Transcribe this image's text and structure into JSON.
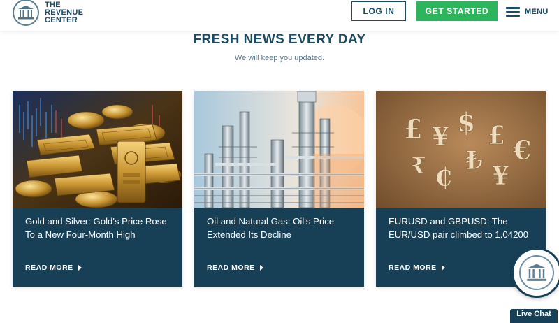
{
  "header": {
    "logo_lines": [
      "THE",
      "REVENUE",
      "CENTER"
    ],
    "login_label": "LOG IN",
    "get_started_label": "GET STARTED",
    "menu_label": "MENU"
  },
  "section": {
    "title": "FRESH NEWS EVERY DAY",
    "subtitle": "We will keep you updated."
  },
  "cards": [
    {
      "title": "Gold and Silver: Gold's Price Rose To a New Four-Month High",
      "read_more": "READ MORE",
      "image": "gold-bars-image"
    },
    {
      "title": "Oil and Natural Gas: Oil's Price Extended Its Decline",
      "read_more": "READ MORE",
      "image": "oil-refinery-image"
    },
    {
      "title": "EURUSD and GBPUSD: The EUR/USD pair climbed to 1.04200",
      "read_more": "READ MORE",
      "image": "currency-symbols-image"
    }
  ],
  "chat": {
    "label": "Live Chat"
  },
  "colors": {
    "brand_navy": "#173f55",
    "accent_green": "#2db55d",
    "heading": "#1b4a63"
  }
}
